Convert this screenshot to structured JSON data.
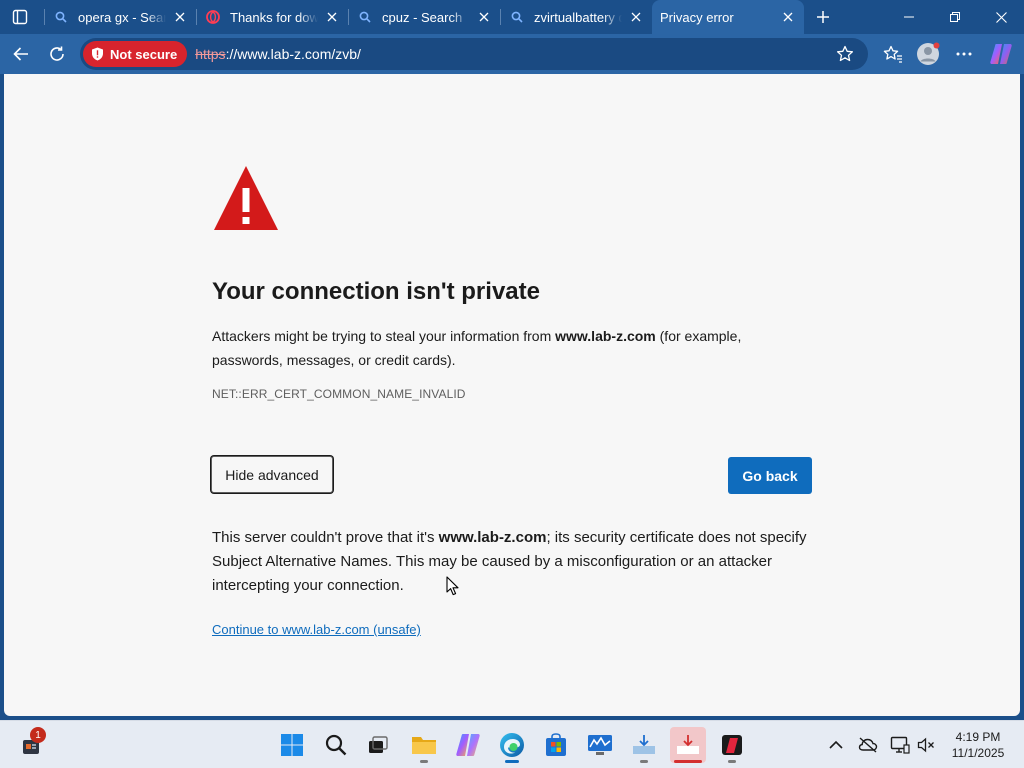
{
  "browser": {
    "tabs": [
      {
        "title": "opera gx - Search",
        "favicon": "search-icon"
      },
      {
        "title": "Thanks for downloading",
        "favicon": "opera-icon"
      },
      {
        "title": "cpuz - Search",
        "favicon": "search-icon"
      },
      {
        "title": "zvirtualbattery download",
        "favicon": "search-icon"
      },
      {
        "title": "Privacy error",
        "favicon": "none",
        "active": true
      }
    ],
    "address": {
      "security_label": "Not secure",
      "url_scheme": "https",
      "url_rest": "://www.lab-z.com/zvb/"
    }
  },
  "page": {
    "headline": "Your connection isn't private",
    "intro_before": "Attackers might be trying to steal your information from ",
    "intro_host": "www.lab-z.com",
    "intro_after": " (for example, passwords, messages, or credit cards).",
    "error_code": "NET::ERR_CERT_COMMON_NAME_INVALID",
    "hide_advanced_label": "Hide advanced",
    "go_back_label": "Go back",
    "details_before": "This server couldn't prove that it's ",
    "details_host": "www.lab-z.com",
    "details_after": "; its security certificate does not specify Subject Alternative Names. This may be caused by a misconfiguration or an attacker intercepting your connection.",
    "proceed_link": "Continue to www.lab-z.com (unsafe)"
  },
  "taskbar": {
    "widget_badge": "1",
    "clock_time": "4:19 PM",
    "clock_date": "11/1/2025"
  },
  "colors": {
    "titlebar": "#1b4f8a",
    "toolbar": "#2b65a5",
    "not_secure": "#d8242d",
    "warning_red": "#d31a1a",
    "primary_button": "#0f6cbd"
  }
}
